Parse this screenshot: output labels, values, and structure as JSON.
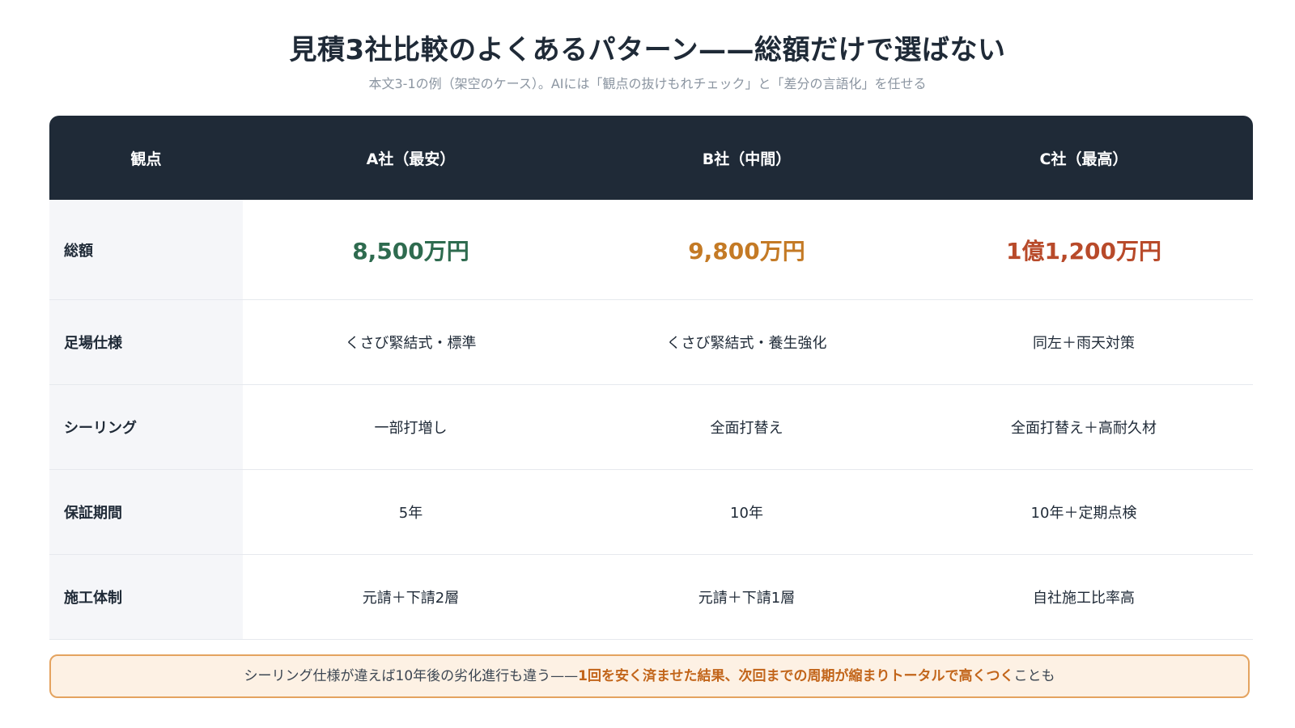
{
  "title": "見積3社比較のよくあるパターン——総額だけで選ばない",
  "subtitle": "本文3-1の例（架空のケース）。AIには「観点の抜けもれチェック」と「差分の言語化」を任せる",
  "table": {
    "headers": [
      "観点",
      "A社（最安）",
      "B社（中間）",
      "C社（最高）"
    ],
    "rows": [
      {
        "label": "総額",
        "cells": [
          "8,500万円",
          "9,800万円",
          "1億1,200万円"
        ]
      },
      {
        "label": "足場仕様",
        "cells": [
          "くさび緊結式・標準",
          "くさび緊結式・養生強化",
          "同左＋雨天対策"
        ]
      },
      {
        "label": "シーリング",
        "cells": [
          "一部打増し",
          "全面打替え",
          "全面打替え＋高耐久材"
        ]
      },
      {
        "label": "保証期間",
        "cells": [
          "5年",
          "10年",
          "10年＋定期点検"
        ]
      },
      {
        "label": "施工体制",
        "cells": [
          "元請＋下請2層",
          "元請＋下請1層",
          "自社施工比率高"
        ]
      }
    ]
  },
  "colors": {
    "header_bg": "#1f2a37",
    "amount_a": "#2e6b4f",
    "amount_b": "#c47a25",
    "amount_c": "#b84a2a",
    "note_accent": "#c2651a"
  },
  "note": {
    "text_before": "シーリング仕様が違えば10年後の劣化進行も違う——",
    "text_emphasis": "1回を安く済ませた結果、次回までの周期が縮まりトータルで高くつく",
    "text_after": "ことも"
  }
}
